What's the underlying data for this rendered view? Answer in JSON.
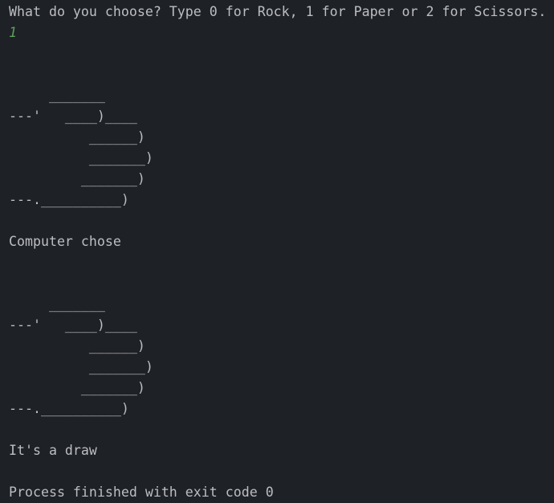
{
  "console": {
    "background_color": "#1e2126",
    "text_color": "#bcbec4",
    "user_input_color": "#5f9e5f",
    "lines": [
      {
        "id": "prompt",
        "kind": "output",
        "text": "What do you choose? Type 0 for Rock, 1 for Paper or 2 for Scissors."
      },
      {
        "id": "user-answer",
        "kind": "user-input",
        "text": "1"
      },
      {
        "id": "blank-1",
        "kind": "blank",
        "text": " "
      },
      {
        "id": "blank-2",
        "kind": "blank",
        "text": " "
      },
      {
        "id": "player-art-1",
        "kind": "art",
        "text": "     _______"
      },
      {
        "id": "player-art-2",
        "kind": "art",
        "text": "---'   ____)____"
      },
      {
        "id": "player-art-3",
        "kind": "art",
        "text": "          ______)"
      },
      {
        "id": "player-art-4",
        "kind": "art",
        "text": "          _______)"
      },
      {
        "id": "player-art-5",
        "kind": "art",
        "text": "         _______)"
      },
      {
        "id": "player-art-6",
        "kind": "art",
        "text": "---.__________)"
      },
      {
        "id": "blank-3",
        "kind": "blank",
        "text": " "
      },
      {
        "id": "computer-label",
        "kind": "output",
        "text": "Computer chose"
      },
      {
        "id": "blank-4",
        "kind": "blank",
        "text": " "
      },
      {
        "id": "blank-5",
        "kind": "blank",
        "text": " "
      },
      {
        "id": "computer-art-1",
        "kind": "art",
        "text": "     _______"
      },
      {
        "id": "computer-art-2",
        "kind": "art",
        "text": "---'   ____)____"
      },
      {
        "id": "computer-art-3",
        "kind": "art",
        "text": "          ______)"
      },
      {
        "id": "computer-art-4",
        "kind": "art",
        "text": "          _______)"
      },
      {
        "id": "computer-art-5",
        "kind": "art",
        "text": "         _______)"
      },
      {
        "id": "computer-art-6",
        "kind": "art",
        "text": "---.__________)"
      },
      {
        "id": "blank-6",
        "kind": "blank",
        "text": " "
      },
      {
        "id": "result",
        "kind": "output",
        "text": "It's a draw"
      },
      {
        "id": "blank-7",
        "kind": "blank",
        "text": " "
      },
      {
        "id": "exit-status",
        "kind": "system",
        "text": "Process finished with exit code 0"
      }
    ]
  }
}
